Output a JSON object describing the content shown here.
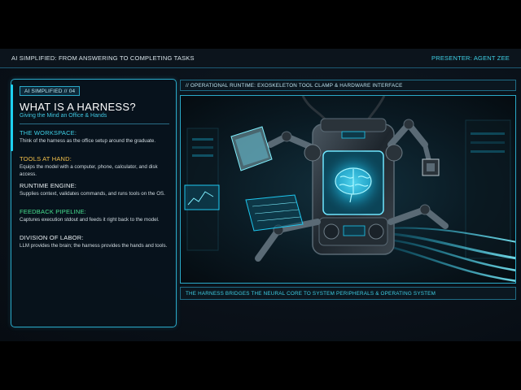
{
  "header": {
    "title": "AI SIMPLIFIED: FROM ANSWERING TO COMPLETING TASKS",
    "presenter": "PRESENTER: AGENT ZEE"
  },
  "slide": {
    "badge": "AI SIMPLIFIED // 04",
    "title": "WHAT IS A HARNESS?",
    "subtitle": "Giving the Mind an Office & Hands",
    "sections": [
      {
        "heading": "THE WORKSPACE:",
        "body": "Think of the harness as the office setup around the graduate.",
        "color": "#3fd0e6"
      },
      {
        "heading": "TOOLS AT HAND:",
        "body": "Equips the model with a computer, phone, calculator, and disk access.",
        "color": "#f2c04a"
      },
      {
        "heading": "RUNTIME ENGINE:",
        "body": "Supplies context, validates commands, and runs tools on the OS.",
        "color": "#eef4f7"
      },
      {
        "heading": "FEEDBACK PIPELINE:",
        "body": "Captures execution stdout and feeds it right back to the model.",
        "color": "#47e08f"
      },
      {
        "heading": "DIVISION OF LABOR:",
        "body": "LLM provides the brain; the harness provides the hands and tools.",
        "color": "#eef4f7"
      }
    ]
  },
  "visual": {
    "header": "// OPERATIONAL RUNTIME: EXOSKELETON TOOL CLAMP & HARDWARE INTERFACE",
    "caption": "THE HARNESS BRIDGES THE NEURAL CORE TO SYSTEM PERIPHERALS & OPERATING SYSTEM"
  },
  "colors": {
    "accent": "#1ed0f0",
    "border": "#2aa9c8",
    "background": "#0a1119"
  },
  "icons": [
    "brain-icon",
    "tablet-icon",
    "chip-icon",
    "robot-arm-icon"
  ]
}
